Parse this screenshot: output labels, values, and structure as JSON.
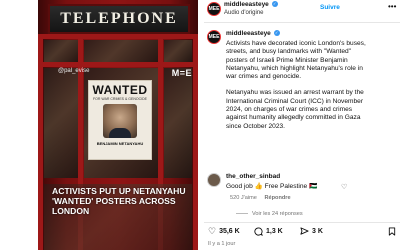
{
  "media": {
    "sign_text": "TELEPHONE",
    "handle_tag": "@pal_evise",
    "brand_tag": "M=E",
    "poster": {
      "headline": "WANTED",
      "subline": "FOR WAR CRIMES & GENOCIDE",
      "name": "BENJAMIN NETANYAHU"
    },
    "caption": "ACTIVISTS PUT UP NETANYAHU 'WANTED' POSTERS ACROSS LONDON"
  },
  "header": {
    "username": "middleeasteye",
    "audio": "Audio d'origine",
    "follow_label": "Suivre",
    "more_label": "•••",
    "avatar_text": "MEE"
  },
  "post": {
    "username": "middleeasteye",
    "paragraph1": "Activists have decorated iconic London's buses, streets, and busy landmarks with \"Wanted\" posters of Israeli Prime Minister Benjamin Netanyahu, which highlight Netanyahu's role in war crimes and genocide.",
    "paragraph2": "Netanyahu was issued an arrest warrant by the International Criminal Court (ICC) in November 2024, on charges of war crimes and crimes against humanity allegedly committed in Gaza since October 2023."
  },
  "comment": {
    "username": "the_other_sinbad",
    "text": "Good job 👍 Free Palestine 🇵🇸",
    "likes": "520 J'aime",
    "reply_label": "Répondre",
    "view_replies": "Voir les 24 réponses"
  },
  "actions": {
    "likes_count": "35,6 K",
    "comments_count": "1,3 K",
    "shares_count": "3 K"
  },
  "timestamp": "Il y a 1 jour",
  "colors": {
    "accent": "#0095f6",
    "verified": "#3897f0",
    "booth_red": "#8e1414"
  }
}
